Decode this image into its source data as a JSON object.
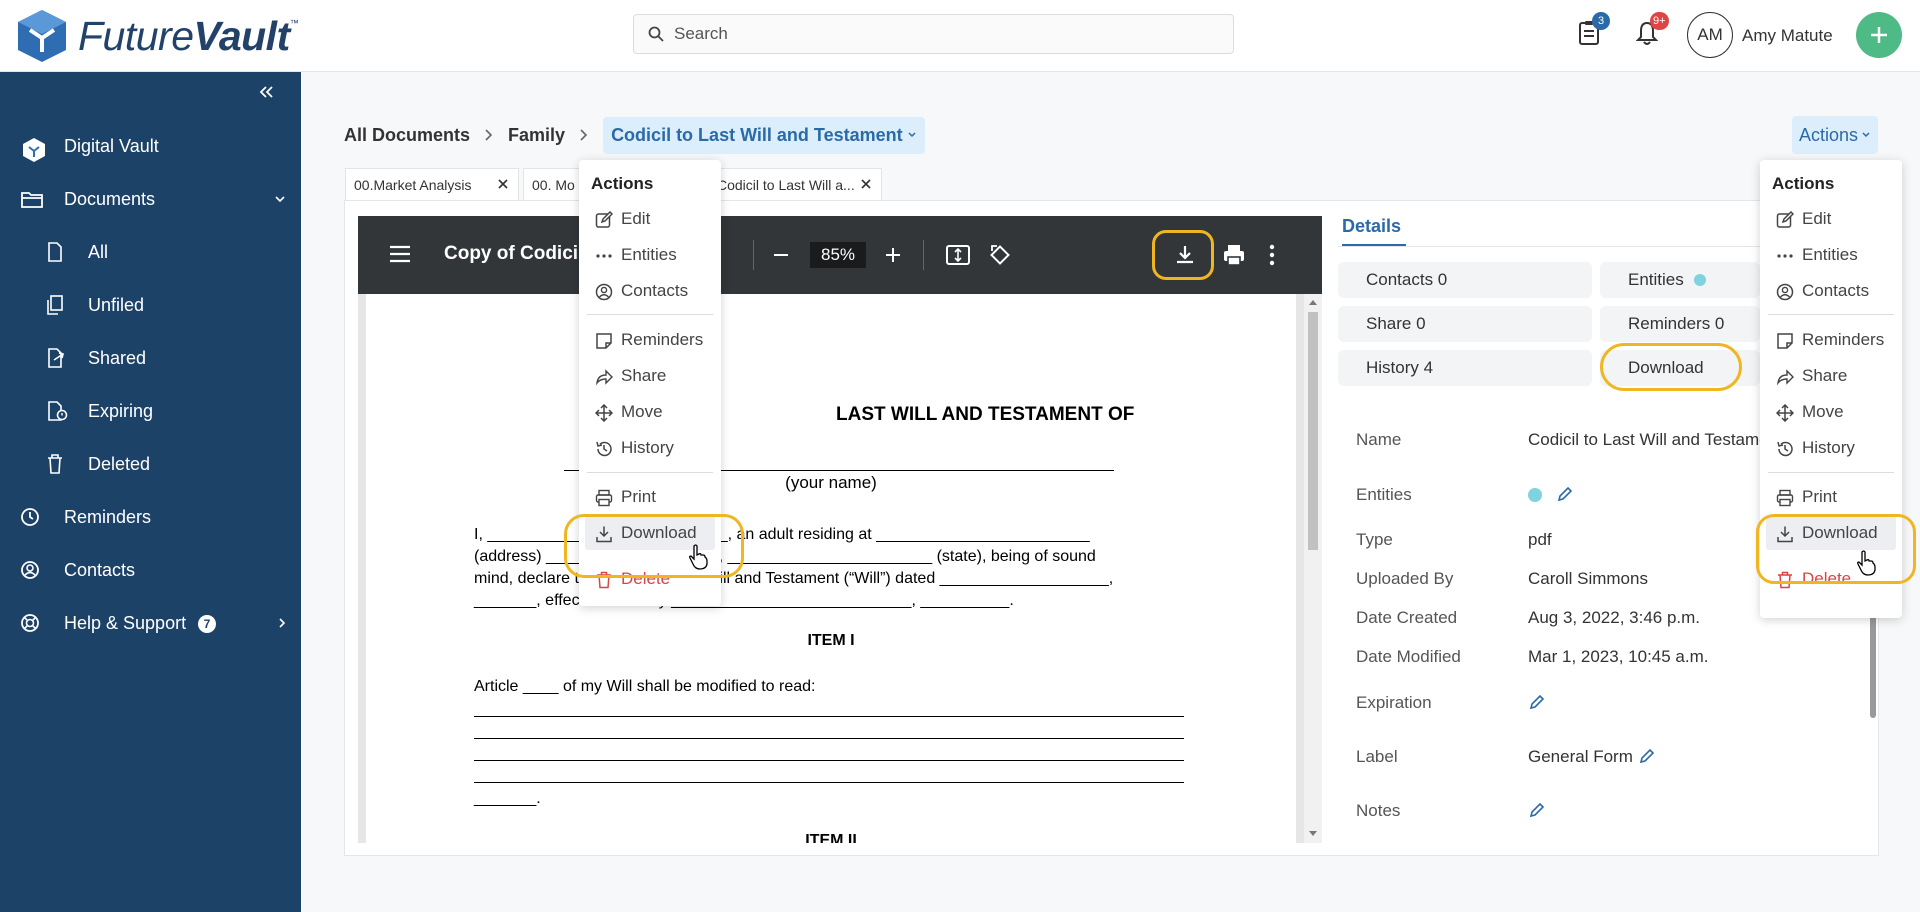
{
  "app": {
    "brand_regular": "Future",
    "brand_bold": "Vault",
    "brand_tm": "™"
  },
  "search": {
    "placeholder": "Search"
  },
  "header": {
    "doc_badge": "3",
    "notif_badge": "9+",
    "avatar_initials": "AM",
    "user_name": "Amy Matute"
  },
  "sidebar": {
    "items": [
      {
        "label": "Digital Vault",
        "icon": "vault-logo-icon"
      },
      {
        "label": "Documents",
        "icon": "folder-icon"
      },
      {
        "label": "All",
        "icon": "file-icon"
      },
      {
        "label": "Unfiled",
        "icon": "copy-icon"
      },
      {
        "label": "Shared",
        "icon": "share-file-icon"
      },
      {
        "label": "Expiring",
        "icon": "expiring-file-icon"
      },
      {
        "label": "Deleted",
        "icon": "trash-icon"
      },
      {
        "label": "Reminders",
        "icon": "clock-icon"
      },
      {
        "label": "Contacts",
        "icon": "person-circle-icon"
      },
      {
        "label": "Help & Support",
        "icon": "lifebuoy-icon"
      }
    ],
    "help_badge": "7"
  },
  "breadcrumb": {
    "root": "All Documents",
    "folder": "Family",
    "current": "Codicil to Last Will and Testament"
  },
  "actions_button": "Actions",
  "doc_tabs": [
    "00.Market Analysis",
    "00. Mo",
    "Codicil to Last Will a..."
  ],
  "viewer": {
    "title": "Copy of Codicil",
    "zoom": "85%",
    "page_heading": "LAST WILL AND TESTAMENT OF",
    "your_name": "(your name)",
    "para1_l1": "I, ___________________________, an adult residing at ________________________",
    "para1_l2": "(address) _______________ (city), _______________________ (state), being of sound",
    "para1_l3": "mind, declare this to be my Last Will and Testament (“Will”) dated ___________________,",
    "para1_l4": "_______, effective on or by ___________________________, __________.",
    "item1": "ITEM I",
    "article": "Article ____ of my Will shall be modified to read:",
    "tail": "_______.",
    "item2": "ITEM II"
  },
  "details": {
    "tab": "Details",
    "pills": {
      "contacts": "Contacts 0",
      "entities": "Entities",
      "share": "Share 0",
      "reminders": "Reminders 0",
      "history": "History 4",
      "download": "Download"
    },
    "fields": [
      {
        "label": "Name",
        "value": "Codicil to Last Will and Testament"
      },
      {
        "label": "Entities",
        "value": ""
      },
      {
        "label": "Type",
        "value": "pdf"
      },
      {
        "label": "Uploaded By",
        "value": "Caroll Simmons"
      },
      {
        "label": "Date Created",
        "value": "Aug 3, 2022, 3:46 p.m."
      },
      {
        "label": "Date Modified",
        "value": "Mar 1, 2023, 10:45 a.m."
      },
      {
        "label": "Expiration",
        "value": ""
      },
      {
        "label": "Label",
        "value": "General Form"
      },
      {
        "label": "Notes",
        "value": ""
      }
    ]
  },
  "menu": {
    "title": "Actions",
    "items": [
      {
        "label": "Edit",
        "icon": "edit-icon"
      },
      {
        "label": "Entities",
        "icon": "dots-icon"
      },
      {
        "label": "Contacts",
        "icon": "person-circle-icon"
      },
      {
        "label": "Reminders",
        "icon": "note-icon"
      },
      {
        "label": "Share",
        "icon": "share-arrow-icon"
      },
      {
        "label": "Move",
        "icon": "move-icon"
      },
      {
        "label": "History",
        "icon": "history-icon"
      },
      {
        "label": "Print",
        "icon": "printer-icon"
      },
      {
        "label": "Download",
        "icon": "download-icon"
      },
      {
        "label": "Delete",
        "icon": "trash-icon"
      }
    ]
  },
  "colors": {
    "sidebar": "#1d4268",
    "accent": "#2a6aa8",
    "highlight_ring": "#f0b622",
    "add_button": "#4eba85",
    "danger": "#d84545"
  }
}
